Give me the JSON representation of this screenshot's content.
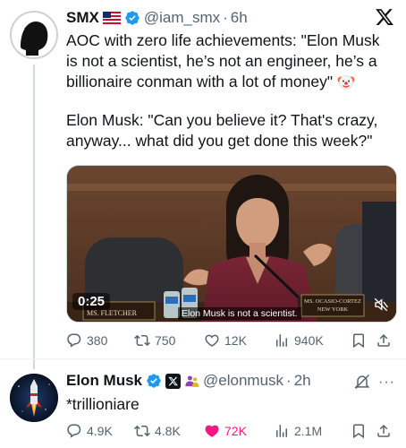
{
  "tweet1": {
    "name": "SMX",
    "handle": "@iam_smx",
    "time": "6h",
    "text_line1": "AOC with zero life achievements: \"Elon Musk",
    "text_line2": "is not a scientist, he’s not an engineer, he’s a",
    "text_line3": "billionaire conman with a lot of money\"",
    "text_line4": "Elon Musk: \"Can you believe it? That's crazy,",
    "text_line5": "anyway... what did you get done this week?\"",
    "video": {
      "duration": "0:25",
      "caption": "Elon Musk is not a scientist.",
      "nameplate_left": "MS. FLETCHER",
      "nameplate_right_line1": "MS. OCASIO-CORTEZ",
      "nameplate_right_line2": "NEW YORK"
    },
    "stats": {
      "replies": "380",
      "reposts": "750",
      "likes": "12K",
      "views": "940K"
    }
  },
  "tweet2": {
    "name": "Elon Musk",
    "handle": "@elonmusk",
    "time": "2h",
    "text": "*trillioniare",
    "stats": {
      "replies": "4.9K",
      "reposts": "4.8K",
      "likes": "72K",
      "views": "2.1M"
    }
  },
  "colors": {
    "verified_blue": "#1d9bf0",
    "like_pink": "#f91880",
    "muted_gray": "#536471",
    "gold_badge": "#e2b719"
  },
  "icons": [
    "x-logo-icon",
    "verified-icon",
    "us-flag-icon",
    "clown-emoji-icon",
    "reply-icon",
    "repost-icon",
    "like-icon",
    "views-icon",
    "bookmark-icon",
    "share-icon",
    "mute-icon",
    "more-icon"
  ]
}
